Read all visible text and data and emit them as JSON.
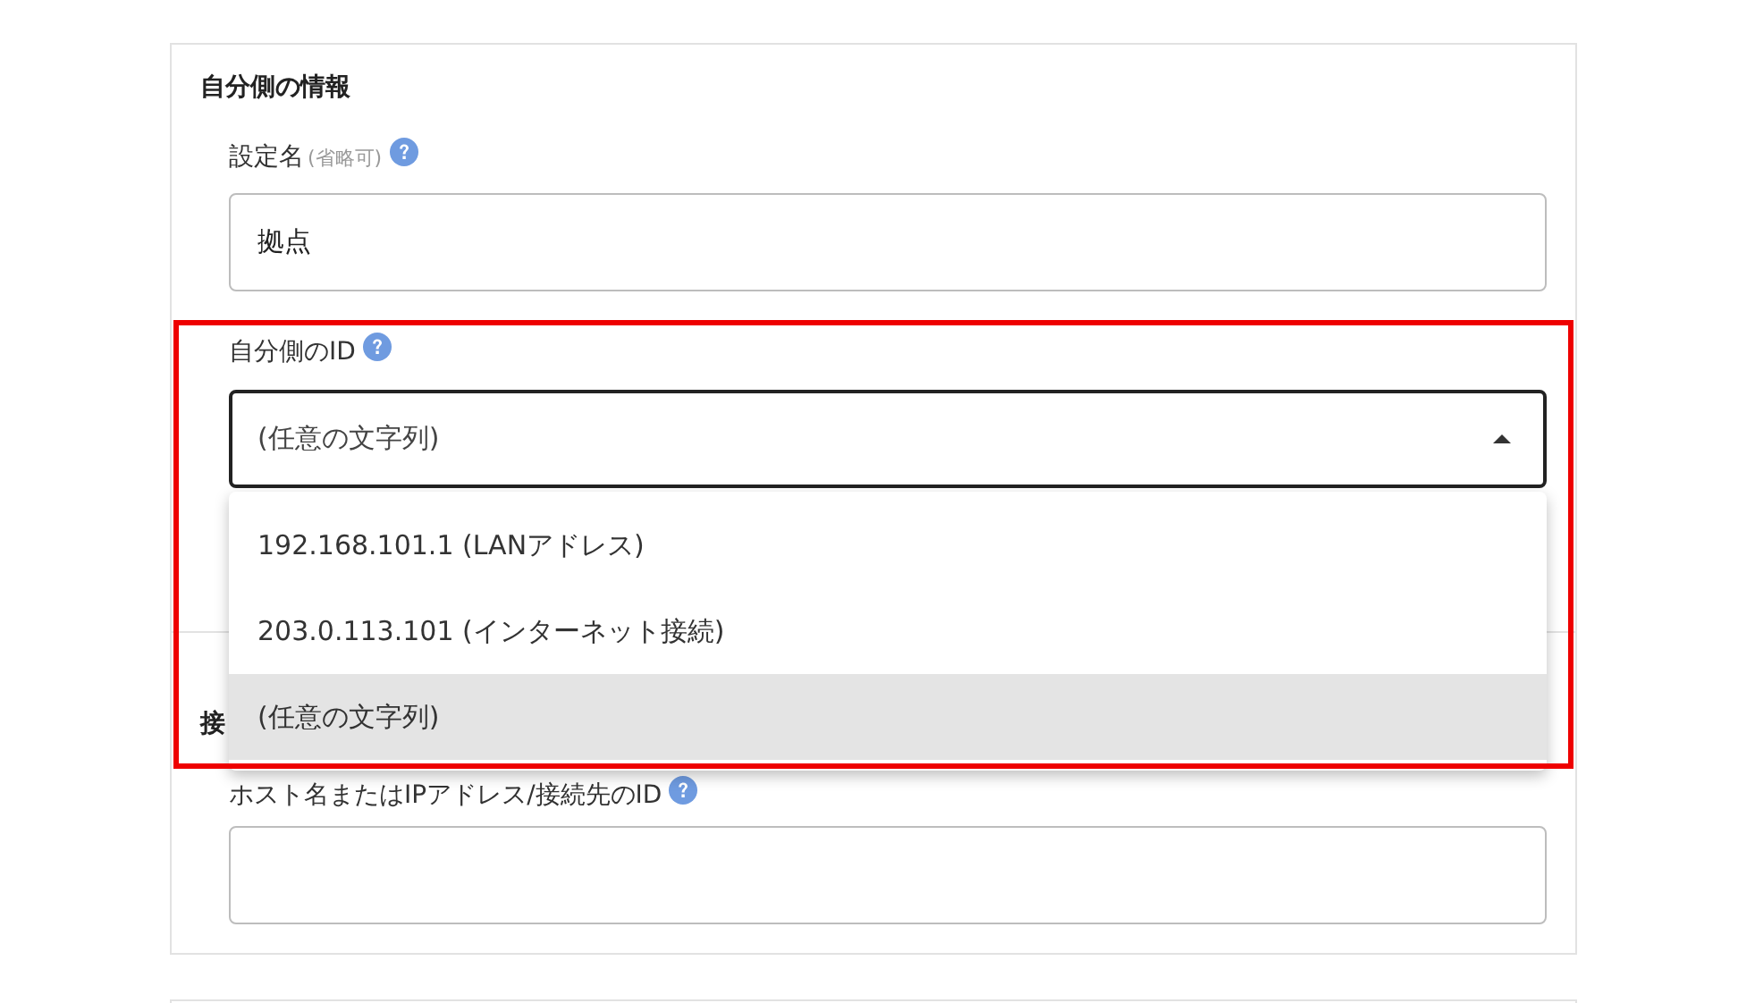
{
  "sections": [
    {
      "heading": "自分側の情報",
      "fields": [
        {
          "kind": "text",
          "label": "設定名",
          "note": "(省略可)",
          "help": true,
          "value": "拠点"
        },
        {
          "kind": "select",
          "label": "自分側のID",
          "help": true,
          "value": "(任意の文字列)",
          "expanded": true,
          "options": [
            {
              "label": "192.168.101.1 (LANアドレス)",
              "selected": false
            },
            {
              "label": "203.0.113.101 (インターネット接続)",
              "selected": false
            },
            {
              "label": "(任意の文字列)",
              "selected": true
            }
          ]
        }
      ]
    },
    {
      "heading": "接",
      "fields": [
        {
          "kind": "text",
          "label": "ホスト名またはIPアドレス/接続先のID",
          "help": true
        }
      ]
    }
  ]
}
